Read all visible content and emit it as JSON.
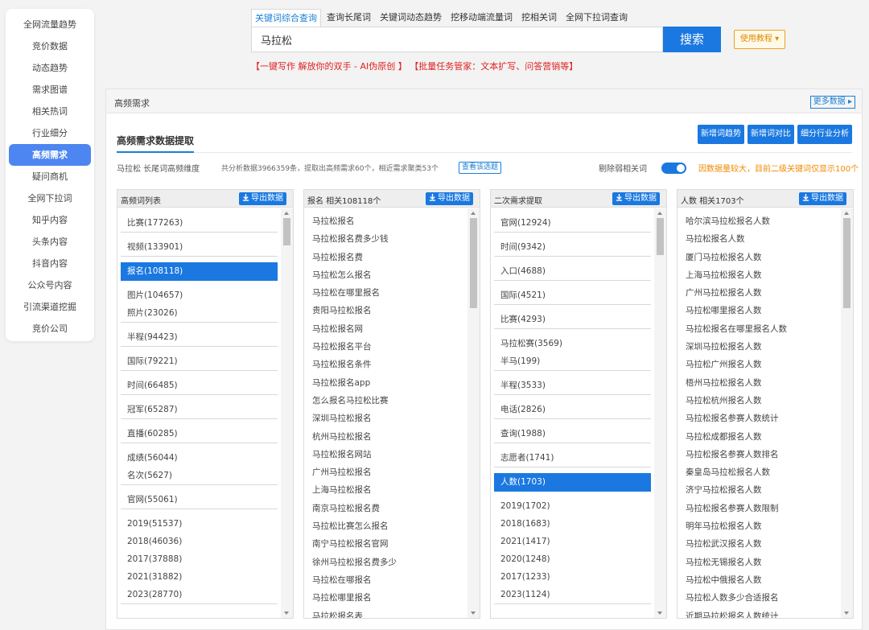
{
  "sidebar": {
    "items": [
      {
        "label": "全网流量趋势",
        "active": false
      },
      {
        "label": "竞价数据",
        "active": false
      },
      {
        "label": "动态趋势",
        "active": false
      },
      {
        "label": "需求图谱",
        "active": false
      },
      {
        "label": "相关热词",
        "active": false
      },
      {
        "label": "行业细分",
        "active": false
      },
      {
        "label": "高频需求",
        "active": true
      },
      {
        "label": "疑问商机",
        "active": false
      },
      {
        "label": "全网下拉词",
        "active": false
      },
      {
        "label": "知乎内容",
        "active": false
      },
      {
        "label": "头条内容",
        "active": false
      },
      {
        "label": "抖音内容",
        "active": false
      },
      {
        "label": "公众号内容",
        "active": false
      },
      {
        "label": "引流渠道挖掘",
        "active": false
      },
      {
        "label": "竞价公司",
        "active": false
      }
    ]
  },
  "search": {
    "tabs": [
      "关键词综合查询",
      "查询长尾词",
      "关键词动态趋势",
      "挖移动端流量词",
      "挖相关词",
      "全网下拉词查询"
    ],
    "active_tab": 0,
    "value": "马拉松",
    "button": "搜索",
    "tutorial": "使用教程 ▾",
    "promo1": "【一键写作 解放你的双手 - AI伪原创 】",
    "promo2": "【批量任务管家：文本扩写、问答营销等】"
  },
  "panel": {
    "title": "高频需求",
    "more": "更多数据 ▸",
    "section_title": "高频需求数据提取",
    "actions": [
      "新增词趋势",
      "新增词对比",
      "细分行业分析"
    ],
    "keyword_dim": "马拉松 长尾词高频维度",
    "stats": "共分析数据3966359条，提取出高频需求60个，相近需求聚类53个",
    "view_btn": "查看该选题",
    "toggle_label": "剔除弱相关词",
    "notice": "因数据量较大，目前二级关键词仅显示100个",
    "export": "导出数据"
  },
  "col1": {
    "title": "高频词列表",
    "groups": [
      {
        "items": [
          "比赛(177263)"
        ],
        "selected": false
      },
      {
        "items": [
          "视频(133901)"
        ],
        "selected": false
      },
      {
        "items": [
          "报名(108118)"
        ],
        "selected": true
      },
      {
        "items": [
          "图片(104657)",
          "照片(23026)"
        ],
        "selected": false
      },
      {
        "items": [
          "半程(94423)"
        ],
        "selected": false
      },
      {
        "items": [
          "国际(79221)"
        ],
        "selected": false
      },
      {
        "items": [
          "时间(66485)"
        ],
        "selected": false
      },
      {
        "items": [
          "冠军(65287)"
        ],
        "selected": false
      },
      {
        "items": [
          "直播(60285)"
        ],
        "selected": false
      },
      {
        "items": [
          "成绩(56044)",
          "名次(5627)"
        ],
        "selected": false
      },
      {
        "items": [
          "官网(55061)"
        ],
        "selected": false
      },
      {
        "items": [
          "2019(51537)",
          "2018(46036)",
          "2017(37888)",
          "2021(31882)",
          "2023(28770)"
        ],
        "selected": false
      }
    ]
  },
  "col2": {
    "title": "报名 相关108118个",
    "items": [
      "马拉松报名",
      "马拉松报名费多少钱",
      "马拉松报名费",
      "马拉松怎么报名",
      "马拉松在哪里报名",
      "贵阳马拉松报名",
      "马拉松报名网",
      "马拉松报名平台",
      "马拉松报名条件",
      "马拉松报名app",
      "怎么报名马拉松比赛",
      "深圳马拉松报名",
      "杭州马拉松报名",
      "马拉松报名网站",
      "广州马拉松报名",
      "上海马拉松报名",
      "南京马拉松报名费",
      "马拉松比赛怎么报名",
      "南宁马拉松报名官网",
      "徐州马拉松报名费多少",
      "马拉松在哪报名",
      "马拉松哪里报名",
      "马拉松报名表"
    ]
  },
  "col3": {
    "title": "二次需求提取",
    "groups": [
      {
        "items": [
          "官网(12924)"
        ],
        "selected": false
      },
      {
        "items": [
          "时间(9342)"
        ],
        "selected": false
      },
      {
        "items": [
          "入口(4688)"
        ],
        "selected": false
      },
      {
        "items": [
          "国际(4521)"
        ],
        "selected": false
      },
      {
        "items": [
          "比赛(4293)"
        ],
        "selected": false
      },
      {
        "items": [
          "马拉松赛(3569)",
          "半马(199)"
        ],
        "selected": false
      },
      {
        "items": [
          "半程(3533)"
        ],
        "selected": false
      },
      {
        "items": [
          "电话(2826)"
        ],
        "selected": false
      },
      {
        "items": [
          "查询(1988)"
        ],
        "selected": false
      },
      {
        "items": [
          "志愿者(1741)"
        ],
        "selected": false
      },
      {
        "items": [
          "人数(1703)"
        ],
        "selected": true
      },
      {
        "items": [
          "2019(1702)",
          "2018(1683)",
          "2021(1417)",
          "2020(1248)",
          "2017(1233)",
          "2023(1124)"
        ],
        "selected": false
      }
    ]
  },
  "col4": {
    "title": "人数 相关1703个",
    "items": [
      "哈尔滨马拉松报名人数",
      "马拉松报名人数",
      "厦门马拉松报名人数",
      "上海马拉松报名人数",
      "广州马拉松报名人数",
      "马拉松哪里报名人数",
      "马拉松报名在哪里报名人数",
      "深圳马拉松报名人数",
      "马拉松广州报名人数",
      "梧州马拉松报名人数",
      "马拉松杭州报名人数",
      "马拉松报名参赛人数统计",
      "马拉松成都报名人数",
      "马拉松报名参赛人数排名",
      "秦皇岛马拉松报名人数",
      "济宁马拉松报名人数",
      "马拉松报名参赛人数限制",
      "明年马拉松报名人数",
      "马拉松武汉报名人数",
      "马拉松无锡报名人数",
      "马拉松中俄报名人数",
      "马拉松人数多少合适报名",
      "近期马拉松报名人数统计"
    ]
  }
}
